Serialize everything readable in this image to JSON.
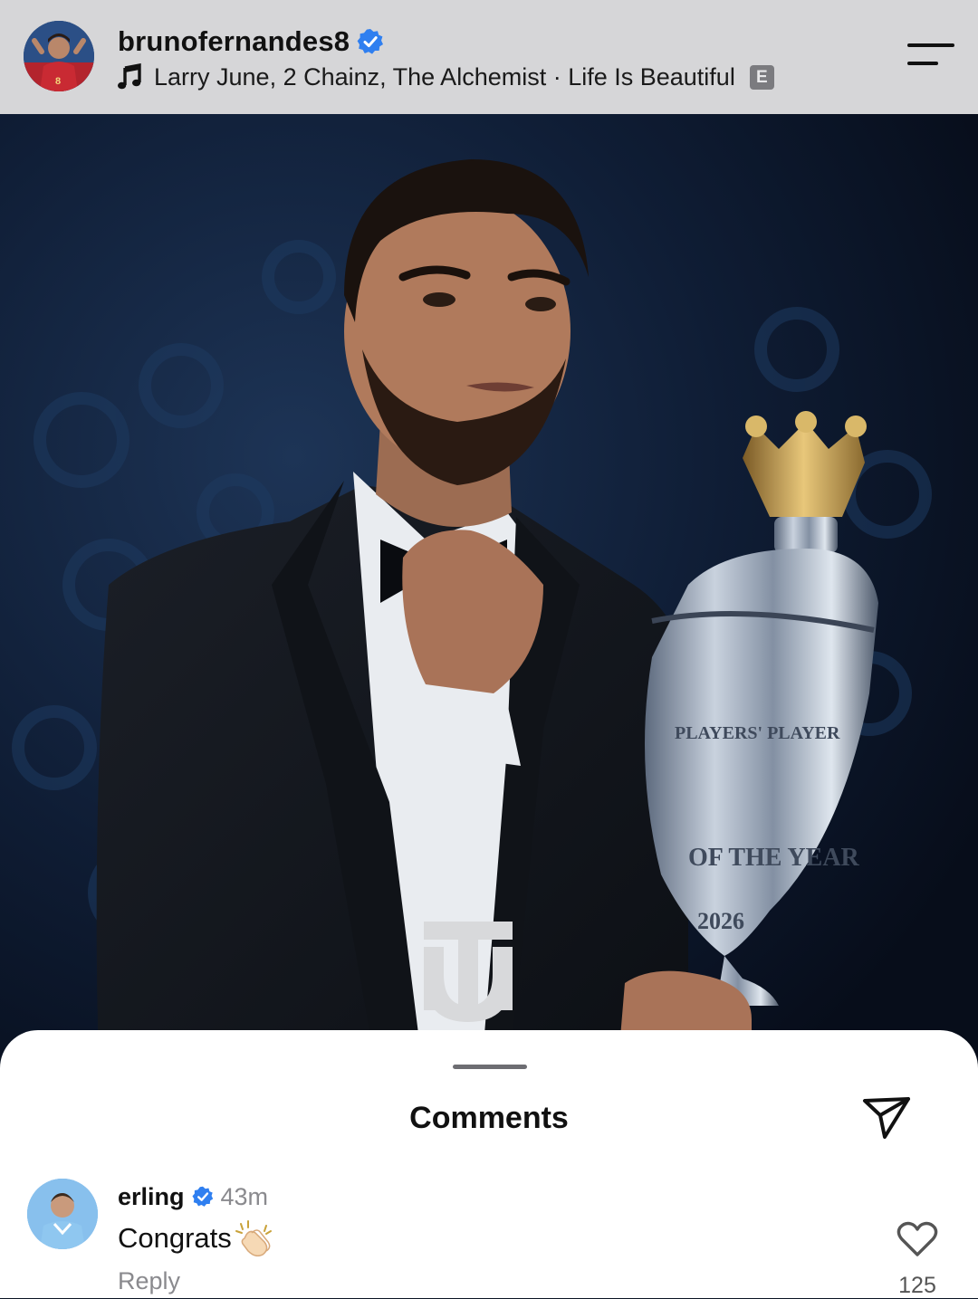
{
  "header": {
    "username": "brunofernandes8",
    "music_track": "Larry June, 2 Chainz, The Alchemist · Life Is Beautiful",
    "explicit_badge": "E",
    "menu_icon": "menu-icon"
  },
  "post": {
    "watermark_logo": "TU",
    "trophy_inscription_1": "PLAYERS' PLAYER",
    "trophy_inscription_2": "OF THE YEAR",
    "trophy_year": "2026"
  },
  "comments_sheet": {
    "title": "Comments",
    "share_icon": "send-icon",
    "comments": [
      {
        "user": "erling",
        "verified": true,
        "time": "43m",
        "text": "Congrats",
        "emoji_icon": "clapping-hands-icon",
        "reply_label": "Reply",
        "like_count": "125"
      }
    ]
  },
  "colors": {
    "header_bg": "#d6d6d8",
    "verified_blue": "#2f7ff0",
    "sheet_bg": "#ffffff",
    "muted_text": "#8a8a8e"
  }
}
